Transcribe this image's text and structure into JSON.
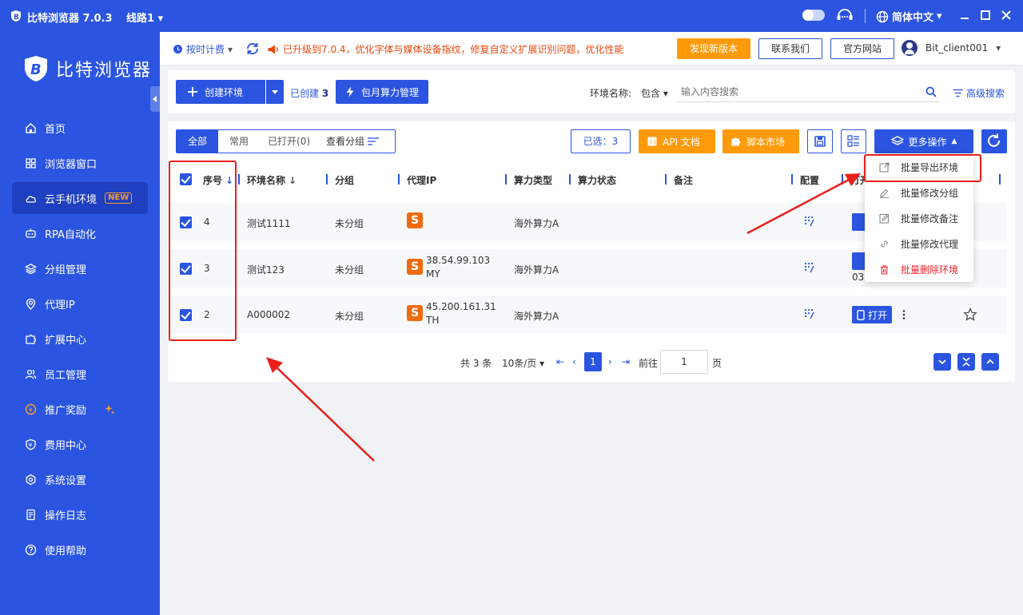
{
  "titlebar": {
    "app_title": "比特浏览器 7.0.3",
    "route": "线路1",
    "language": "简体中文"
  },
  "sidebar": {
    "logo_text": "比特浏览器",
    "items": [
      {
        "label": "首页",
        "icon": "home-icon"
      },
      {
        "label": "浏览器窗口",
        "icon": "grid-icon"
      },
      {
        "label": "云手机环境",
        "icon": "cloud-icon",
        "badge": "NEW"
      },
      {
        "label": "RPA自动化",
        "icon": "robot-icon"
      },
      {
        "label": "分组管理",
        "icon": "layers-icon"
      },
      {
        "label": "代理IP",
        "icon": "location-icon"
      },
      {
        "label": "扩展中心",
        "icon": "puzzle-icon"
      },
      {
        "label": "员工管理",
        "icon": "users-icon"
      },
      {
        "label": "推广奖励",
        "icon": "reward-icon"
      },
      {
        "label": "费用中心",
        "icon": "shield-yen-icon"
      },
      {
        "label": "系统设置",
        "icon": "gear-icon"
      },
      {
        "label": "操作日志",
        "icon": "log-icon"
      },
      {
        "label": "使用帮助",
        "icon": "help-icon"
      }
    ]
  },
  "topbar": {
    "billing": "按时计费",
    "notice": "已升级到7.0.4，优化字体与媒体设备指纹，修复自定义扩展识别问题，优化性能",
    "new_version": "发现新版本",
    "contact": "联系我们",
    "official_site": "官方网站",
    "user": "Bit_client001"
  },
  "actions": {
    "create": "创建环境",
    "created_label": "已创建",
    "created_count": "3",
    "monthly": "包月算力管理",
    "search_label": "环境名称:",
    "search_match": "包含",
    "search_placeholder": "输入内容搜索",
    "advanced_search": "高级搜索"
  },
  "list": {
    "tabs": [
      "全部",
      "常用",
      "已打开(0)",
      "查看分组"
    ],
    "selected": "已选：3",
    "api_docs": "API 文档",
    "script_market": "脚本市场",
    "more_ops": "更多操作",
    "columns": [
      "序号",
      "环境名称",
      "分组",
      "代理IP",
      "算力类型",
      "算力状态",
      "备注",
      "配置",
      "打开"
    ],
    "rows": [
      {
        "seq": "4",
        "name": "测试1111",
        "group": "未分组",
        "ip": "",
        "region": "",
        "compute": "海外算力A",
        "extra": ""
      },
      {
        "seq": "3",
        "name": "测试123",
        "group": "未分组",
        "ip": "38.54.99.103",
        "region": "MY",
        "compute": "海外算力A",
        "extra": "03-"
      },
      {
        "seq": "2",
        "name": "A000002",
        "group": "未分组",
        "ip": "45.200.161.31",
        "region": "TH",
        "compute": "海外算力A",
        "extra": ""
      }
    ],
    "open_label": "打开",
    "proxy_badge": "S"
  },
  "pagination": {
    "total": "共 3 条",
    "per_page": "10条/页",
    "current": "1",
    "goto_label": "前往",
    "goto_value": "1",
    "page_suffix": "页"
  },
  "dropdown": {
    "items": [
      {
        "label": "批量导出环境",
        "icon": "export-icon"
      },
      {
        "label": "批量修改分组",
        "icon": "edit-group-icon"
      },
      {
        "label": "批量修改备注",
        "icon": "edit-note-icon"
      },
      {
        "label": "批量修改代理",
        "icon": "link-icon"
      },
      {
        "label": "批量删除环境",
        "icon": "trash-icon"
      }
    ]
  },
  "colors": {
    "primary": "#2b55e0",
    "orange": "#ff9a0b",
    "danger": "#f5222d",
    "annotation_red": "#e8201b"
  }
}
